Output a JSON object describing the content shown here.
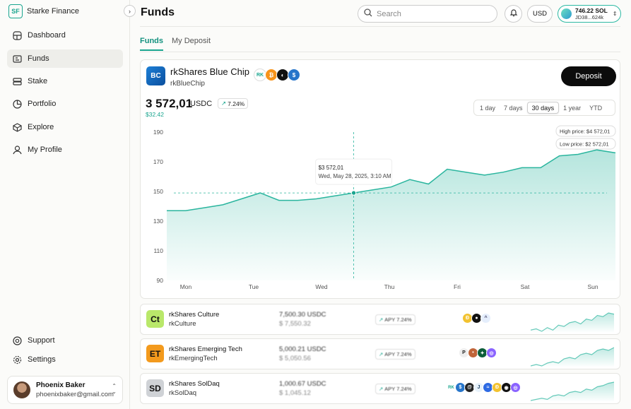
{
  "app": {
    "name": "Starke Finance",
    "logo_text": "SF"
  },
  "sidebar": {
    "items": [
      {
        "label": "Dashboard",
        "icon": "grid-icon"
      },
      {
        "label": "Funds",
        "icon": "funds-icon",
        "active": true
      },
      {
        "label": "Stake",
        "icon": "stack-icon"
      },
      {
        "label": "Portfolio",
        "icon": "pie-chart-icon"
      },
      {
        "label": "Explore",
        "icon": "cube-icon"
      },
      {
        "label": "My Profile",
        "icon": "user-icon"
      }
    ],
    "bottom": [
      {
        "label": "Support",
        "icon": "lifebuoy-icon"
      },
      {
        "label": "Settings",
        "icon": "gear-icon"
      }
    ],
    "user": {
      "name": "Phoenix Baker",
      "email": "phoenixbaker@gmail.com"
    }
  },
  "header": {
    "title": "Funds",
    "search_placeholder": "Search",
    "currency": "USD",
    "wallet": {
      "amount": "746.22 SOL",
      "address": "JD38...624k"
    }
  },
  "tabs": [
    {
      "label": "Funds",
      "active": true
    },
    {
      "label": "My Deposit"
    }
  ],
  "fund": {
    "logo": "BC",
    "name": "rkShares Blue Chip",
    "symbol": "rkBlueChip",
    "deposit_label": "Deposit",
    "price": "3 572,01",
    "unit": "USDC",
    "change_pct": "7.24%",
    "change_abs": "$32.42",
    "ranges": [
      {
        "label": "1 day"
      },
      {
        "label": "7 days"
      },
      {
        "label": "30 days",
        "active": true
      },
      {
        "label": "1 year"
      },
      {
        "label": "YTD"
      }
    ],
    "assets": [
      {
        "icon": "rk-icon",
        "bg": "#ffffff",
        "fg": "#1aa58f",
        "text": "RK"
      },
      {
        "icon": "bitcoin-icon",
        "bg": "#f7931a",
        "fg": "#fff",
        "text": "₿"
      },
      {
        "icon": "mask-icon",
        "bg": "#111111",
        "fg": "#fff",
        "text": "◐"
      },
      {
        "icon": "usdc-icon",
        "bg": "#2775ca",
        "fg": "#fff",
        "text": "$"
      }
    ]
  },
  "chart_data": {
    "type": "area",
    "x": [
      "Mon",
      "Tue",
      "Wed",
      "Thu",
      "Fri",
      "Sat",
      "Sun"
    ],
    "y_ticks": [
      190,
      170,
      150,
      130,
      110,
      90
    ],
    "ylim": [
      90,
      190
    ],
    "series": [
      {
        "values": [
          137,
          137,
          139,
          141,
          145,
          149,
          144,
          144,
          145,
          147,
          149,
          151,
          153,
          158,
          155,
          165,
          163,
          161,
          163,
          166,
          166,
          174,
          175,
          178,
          176
        ]
      }
    ],
    "tooltip": {
      "value": "$3 572,01",
      "date": "Wed, May 28, 2025, 3:10 AM"
    },
    "tooltip_point": {
      "x_index": 10,
      "value": 149
    },
    "high_label": "High price: $4 572,01",
    "low_label": "Low price: $2 572,01",
    "color": "#2ab59e",
    "grid": false
  },
  "rows": [
    {
      "logo": "Ct",
      "logo_bg": "#b9e86a",
      "name": "rkShares Culture",
      "symbol": "rkCulture",
      "balance": "7,500.30 USDC",
      "usd": "$ 7,550.32",
      "apy": "APY 7.24%",
      "chips": [
        {
          "icon": "doge-icon",
          "bg": "#f2c230",
          "text": "Ð"
        },
        {
          "icon": "dark-token-icon",
          "bg": "#111",
          "text": "●"
        },
        {
          "icon": "cat-icon",
          "bg": "#e5eefc",
          "text": "^"
        }
      ],
      "spark": [
        14,
        15,
        13,
        16,
        14,
        18,
        17,
        20,
        21,
        19,
        23,
        22,
        26,
        25,
        28,
        27
      ]
    },
    {
      "logo": "ET",
      "logo_bg": "#f39a1d",
      "name": "rkShares Emerging Tech",
      "symbol": "rkEmergingTech",
      "balance": "5,000.21 USDC",
      "usd": "$ 5,050.56",
      "apy": "APY 7.24%",
      "chips": [
        {
          "icon": "p-token-icon",
          "bg": "#eeeeee",
          "text": "P"
        },
        {
          "icon": "person-token-icon",
          "bg": "#c0653a",
          "text": "•"
        },
        {
          "icon": "green-token-icon",
          "bg": "#0d5e3a",
          "text": "✦"
        },
        {
          "icon": "purple-token-icon",
          "bg": "#8a63ff",
          "text": "◎"
        }
      ],
      "spark": [
        13,
        14,
        13,
        15,
        16,
        15,
        18,
        19,
        18,
        21,
        22,
        21,
        24,
        25,
        24,
        26
      ]
    },
    {
      "logo": "SD",
      "logo_bg": "#cfd2d6",
      "name": "rkShares SolDaq",
      "symbol": "rkSolDaq",
      "balance": "1,000.67 USDC",
      "usd": "$ 1,045.12",
      "apy": "APY 7.24%",
      "chips": [
        {
          "icon": "rk-icon",
          "bg": "#ffffff",
          "text": "RK"
        },
        {
          "icon": "usdc-icon",
          "bg": "#2775ca",
          "text": "$"
        },
        {
          "icon": "swirl-icon",
          "bg": "#222",
          "text": "@"
        },
        {
          "icon": "jup-icon",
          "bg": "#e8f2fb",
          "text": "J"
        },
        {
          "icon": "blue-token-icon",
          "bg": "#2d6ae3",
          "text": "≈"
        },
        {
          "icon": "doge-icon",
          "bg": "#f2c230",
          "text": "Ð"
        },
        {
          "icon": "dark-token-icon",
          "bg": "#111",
          "text": "◉"
        },
        {
          "icon": "purple-token-icon",
          "bg": "#8a63ff",
          "text": "◎"
        }
      ],
      "spark": [
        12,
        13,
        14,
        13,
        16,
        17,
        16,
        19,
        20,
        19,
        22,
        21,
        24,
        25,
        27,
        28
      ]
    }
  ]
}
